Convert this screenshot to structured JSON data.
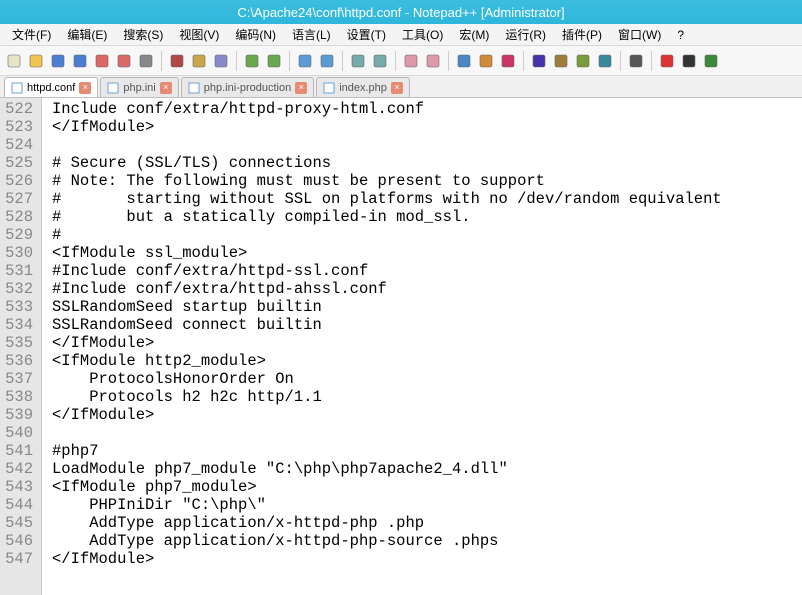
{
  "titlebar": "C:\\Apache24\\conf\\httpd.conf - Notepad++ [Administrator]",
  "menus": [
    "文件(F)",
    "编辑(E)",
    "搜索(S)",
    "视图(V)",
    "编码(N)",
    "语言(L)",
    "设置(T)",
    "工具(O)",
    "宏(M)",
    "运行(R)",
    "插件(P)",
    "窗口(W)",
    "?"
  ],
  "tabs": [
    {
      "label": "httpd.conf",
      "active": true
    },
    {
      "label": "php.ini",
      "active": false
    },
    {
      "label": "php.ini-production",
      "active": false
    },
    {
      "label": "index.php",
      "active": false
    }
  ],
  "first_line_number": 522,
  "lines": [
    "Include conf/extra/httpd-proxy-html.conf",
    "</IfModule>",
    "",
    "# Secure (SSL/TLS) connections",
    "# Note: The following must must be present to support",
    "#       starting without SSL on platforms with no /dev/random equivalent",
    "#       but a statically compiled-in mod_ssl.",
    "#",
    "<IfModule ssl_module>",
    "#Include conf/extra/httpd-ssl.conf",
    "#Include conf/extra/httpd-ahssl.conf",
    "SSLRandomSeed startup builtin",
    "SSLRandomSeed connect builtin",
    "</IfModule>",
    "<IfModule http2_module>",
    "    ProtocolsHonorOrder On",
    "    Protocols h2 h2c http/1.1",
    "</IfModule>",
    "",
    "#php7",
    "LoadModule php7_module \"C:\\php\\php7apache2_4.dll\"",
    "<IfModule php7_module>",
    "    PHPIniDir \"C:\\php\\\"",
    "    AddType application/x-httpd-php .php",
    "    AddType application/x-httpd-php-source .phps",
    "</IfModule>"
  ],
  "toolbar_icons": [
    "new-file-icon",
    "open-folder-icon",
    "save-icon",
    "save-all-icon",
    "close-icon",
    "close-all-icon",
    "print-icon",
    "sep",
    "cut-icon",
    "copy-icon",
    "paste-icon",
    "sep",
    "undo-icon",
    "redo-icon",
    "sep",
    "find-icon",
    "replace-icon",
    "sep",
    "zoom-in-icon",
    "zoom-out-icon",
    "sep",
    "sync-v-icon",
    "sync-h-icon",
    "sep",
    "wrap-icon",
    "show-all-icon",
    "indent-guide-icon",
    "sep",
    "lang-icon",
    "doc-map-icon",
    "func-list-icon",
    "folder-tree-icon",
    "sep",
    "monitor-icon",
    "sep",
    "record-icon",
    "stop-icon",
    "play-icon"
  ],
  "icon_colors": {
    "new-file-icon": "#e8e4c8",
    "open-folder-icon": "#f2c34d",
    "save-icon": "#4a7fd3",
    "save-all-icon": "#4a7fd3",
    "close-icon": "#d66",
    "close-all-icon": "#d66",
    "print-icon": "#888",
    "cut-icon": "#b04848",
    "copy-icon": "#c9a64a",
    "paste-icon": "#8a8acb",
    "undo-icon": "#6aa84f",
    "redo-icon": "#6aa84f",
    "find-icon": "#5b9bd5",
    "replace-icon": "#5b9bd5",
    "zoom-in-icon": "#7aa",
    "zoom-out-icon": "#7aa",
    "sync-v-icon": "#d9a",
    "sync-h-icon": "#d9a",
    "wrap-icon": "#4b87c5",
    "show-all-icon": "#d38a35",
    "indent-guide-icon": "#c36",
    "lang-icon": "#43a",
    "doc-map-icon": "#9c7d3a",
    "func-list-icon": "#7a9c3a",
    "folder-tree-icon": "#3a889c",
    "monitor-icon": "#555",
    "record-icon": "#d33",
    "stop-icon": "#333",
    "play-icon": "#3a8a3a"
  }
}
